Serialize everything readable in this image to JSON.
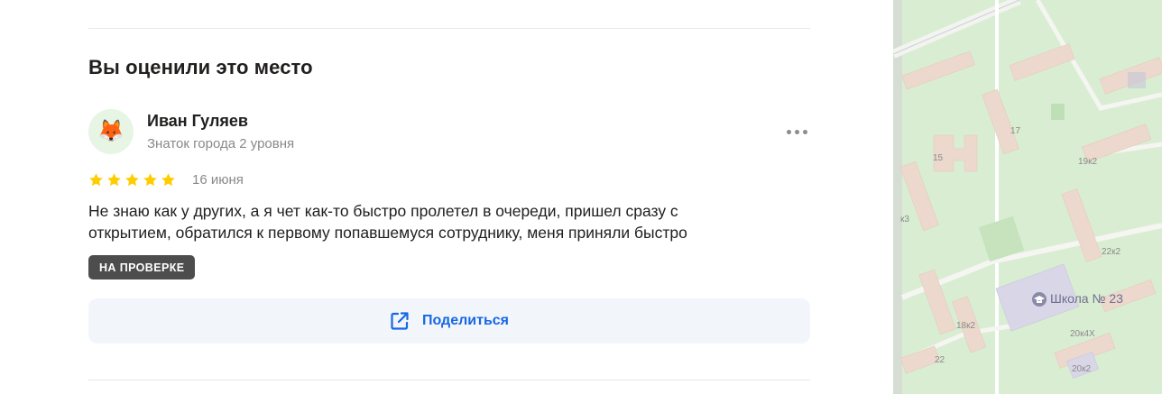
{
  "section": {
    "title": "Вы оценили это место"
  },
  "review": {
    "author": {
      "name": "Иван Гуляев",
      "level": "Знаток города 2 уровня",
      "avatar_emoji": "🦊"
    },
    "rating": 5,
    "max_rating": 5,
    "date": "16 июня",
    "text_lines": [
      "Не знаю как у других, а я чет как-то быстро пролетел в очереди, пришел сразу с",
      "открытием, обратился к первому попавшемуся сотруднику, меня приняли быстро"
    ],
    "status_badge": "НА ПРОВЕРКЕ",
    "more_icon": "more-dots-icon"
  },
  "share": {
    "label": "Поделиться",
    "icon": "share-external-icon"
  },
  "map": {
    "labels": {
      "b17": "17",
      "b15": "15",
      "b19k2": "19к2",
      "bk3": "к3",
      "b22k2": "22к2",
      "school": "Школа № 23",
      "b18k2": "18к2",
      "b20k4x": "20к4Х",
      "b22": "22",
      "b20k2": "20к2"
    },
    "school_icon": "school-cap-icon"
  },
  "colors": {
    "star": "#fc0",
    "accent": "#1767e6",
    "badge_bg": "#4d4d4d",
    "share_bg": "#f2f5fa",
    "map_green": "#d8ecd0"
  }
}
